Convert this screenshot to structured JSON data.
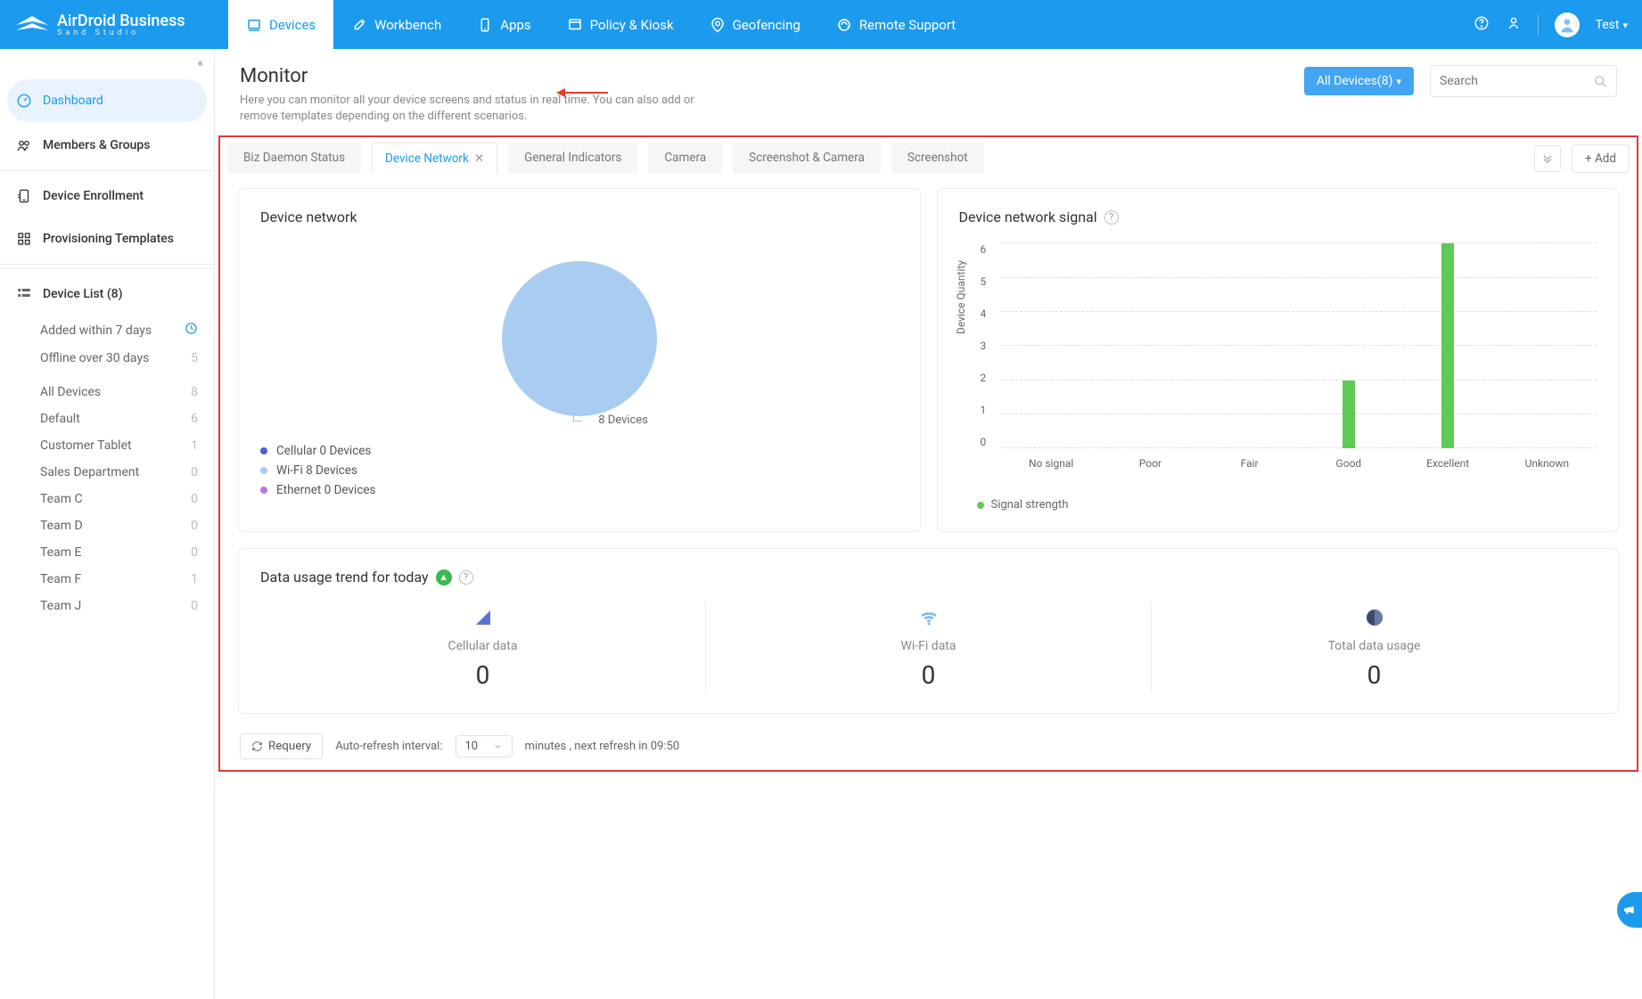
{
  "brand": {
    "name": "AirDroid Business",
    "sub": "Sand Studio"
  },
  "topnav": [
    {
      "label": "Devices",
      "icon": "devices"
    },
    {
      "label": "Workbench",
      "icon": "workbench"
    },
    {
      "label": "Apps",
      "icon": "apps"
    },
    {
      "label": "Policy & Kiosk",
      "icon": "policy"
    },
    {
      "label": "Geofencing",
      "icon": "geofencing"
    },
    {
      "label": "Remote Support",
      "icon": "support"
    }
  ],
  "user": {
    "name": "Test"
  },
  "sidebar": {
    "items": [
      {
        "label": "Dashboard",
        "icon": "dashboard",
        "active": true
      },
      {
        "label": "Members & Groups",
        "icon": "members"
      },
      {
        "label": "Device Enrollment",
        "icon": "enroll"
      },
      {
        "label": "Provisioning Templates",
        "icon": "prov"
      }
    ],
    "deviceList": {
      "title": "Device List (8)",
      "recent": [
        {
          "label": "Added within 7 days",
          "badge": "clock",
          "count": ""
        },
        {
          "label": "Offline over 30 days",
          "count": "5"
        }
      ],
      "groups": [
        {
          "label": "All Devices",
          "count": "8"
        },
        {
          "label": "Default",
          "count": "6"
        },
        {
          "label": "Customer Tablet",
          "count": "1"
        },
        {
          "label": "Sales Department",
          "count": "0"
        },
        {
          "label": "Team C",
          "count": "0"
        },
        {
          "label": "Team D",
          "count": "0"
        },
        {
          "label": "Team E",
          "count": "0"
        },
        {
          "label": "Team F",
          "count": "1"
        },
        {
          "label": "Team J",
          "count": "0"
        }
      ]
    }
  },
  "page": {
    "title": "Monitor",
    "description": "Here you can monitor all your device screens and status in real time. You can also add or remove templates depending on the different scenarios.",
    "selector": "All Devices(8)",
    "searchPlaceholder": "Search"
  },
  "tabs": [
    {
      "label": "Biz Daemon Status"
    },
    {
      "label": "Device Network",
      "active": true,
      "closable": true
    },
    {
      "label": "General Indicators"
    },
    {
      "label": "Camera"
    },
    {
      "label": "Screenshot & Camera"
    },
    {
      "label": "Screenshot"
    }
  ],
  "addLabel": "Add",
  "cards": {
    "network": {
      "title": "Device network",
      "centerLabel": "8 Devices",
      "legend": [
        {
          "color": "#4a5fd8",
          "label": "Cellular 0 Devices"
        },
        {
          "color": "#a8cdf0",
          "label": "Wi-Fi 8 Devices"
        },
        {
          "color": "#b876e6",
          "label": "Ethernet 0 Devices"
        }
      ]
    },
    "signal": {
      "title": "Device network signal",
      "legendLabel": "Signal strength"
    },
    "usage": {
      "title": "Data usage trend for today",
      "cols": [
        {
          "label": "Cellular data",
          "value": "0",
          "icon": "cell"
        },
        {
          "label": "Wi-Fi data",
          "value": "0",
          "icon": "wifi"
        },
        {
          "label": "Total data usage",
          "value": "0",
          "icon": "total"
        }
      ]
    }
  },
  "footer": {
    "requery": "Requery",
    "autorefreshLabel": "Auto-refresh interval:",
    "interval": "10",
    "tail": "minutes , next refresh in 09:50"
  },
  "chart_data": [
    {
      "type": "pie",
      "title": "Device network",
      "series": [
        {
          "name": "Devices",
          "values": [
            0,
            8,
            0
          ]
        }
      ],
      "categories": [
        "Cellular",
        "Wi-Fi",
        "Ethernet"
      ],
      "total_label": "8 Devices"
    },
    {
      "type": "bar",
      "title": "Device network signal",
      "ylabel": "Device Quantity",
      "categories": [
        "No signal",
        "Poor",
        "Fair",
        "Good",
        "Excellent",
        "Unknown"
      ],
      "values": [
        0,
        0,
        0,
        2,
        6,
        0
      ],
      "ylim": [
        0,
        6
      ],
      "legend": [
        "Signal strength"
      ]
    }
  ]
}
